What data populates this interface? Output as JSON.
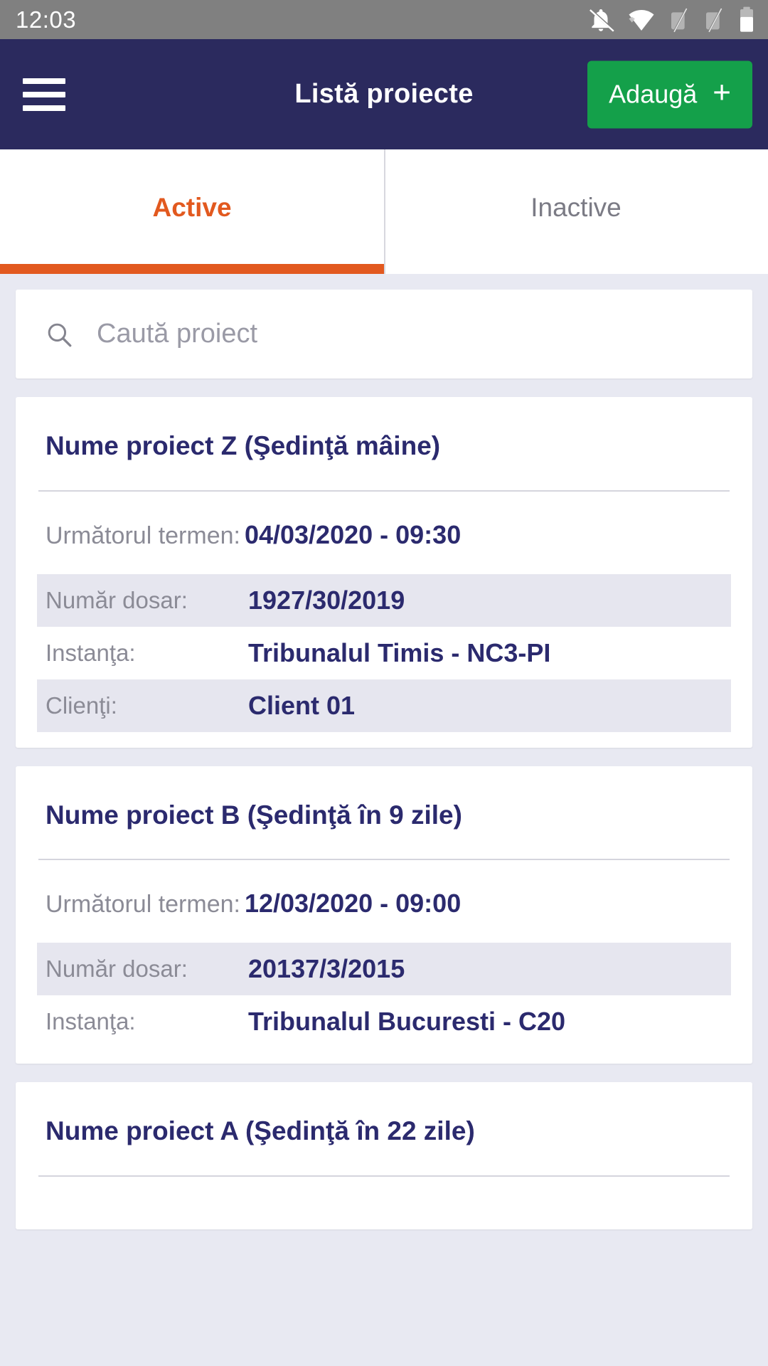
{
  "status_bar": {
    "time": "12:03",
    "icons": [
      {
        "name": "notifications-off-icon"
      },
      {
        "name": "wifi-icon"
      },
      {
        "name": "signal-off-icon-1"
      },
      {
        "name": "signal-off-icon-2"
      },
      {
        "name": "battery-icon"
      }
    ]
  },
  "app_bar": {
    "menu_icon": "hamburger-menu-icon",
    "title": "Listă proiecte",
    "add_button": {
      "label": "Adaugă",
      "plus": "+",
      "color": "#14a04a"
    },
    "background": "#2b2a5e"
  },
  "tabs": {
    "active_color": "#e2591f",
    "inactive_color": "#7b7b85",
    "items": [
      {
        "label": "Active",
        "selected": true
      },
      {
        "label": "Inactive",
        "selected": false
      }
    ]
  },
  "search": {
    "icon": "search-icon",
    "value": "",
    "placeholder": "Caută proiect"
  },
  "labels": {
    "next_term": "Următorul termen:",
    "file_number": "Număr dosar:",
    "court": "Instanţa:",
    "clients": "Clienţi:"
  },
  "projects": [
    {
      "title": "Nume proiect Z (Şedinţă mâine)",
      "next_term": "04/03/2020  - 09:30",
      "rows": [
        {
          "label": "Număr dosar:",
          "value": "1927/30/2019",
          "striped": true
        },
        {
          "label": "Instanţa:",
          "value": "Tribunalul Timis - NC3-PI",
          "striped": false
        },
        {
          "label": "Clienţi:",
          "value": "Client 01",
          "striped": true
        }
      ]
    },
    {
      "title": "Nume proiect B (Şedinţă în 9 zile)",
      "next_term": "12/03/2020  - 09:00",
      "rows": [
        {
          "label": "Număr dosar:",
          "value": "20137/3/2015",
          "striped": true
        },
        {
          "label": "Instanţa:",
          "value": "Tribunalul Bucuresti - C20",
          "striped": false
        }
      ]
    },
    {
      "title": "Nume proiect A (Şedinţă în 22 zile)",
      "next_term": "",
      "rows": []
    }
  ]
}
